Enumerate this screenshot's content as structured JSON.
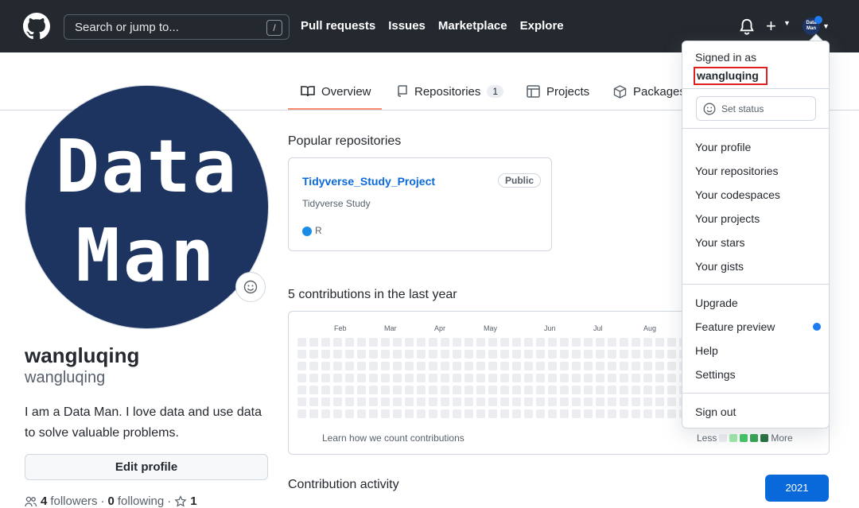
{
  "header": {
    "search_placeholder": "Search or jump to...",
    "search_shortcut": "/",
    "nav": [
      "Pull requests",
      "Issues",
      "Marketplace",
      "Explore"
    ],
    "avatar_text_line1": "Data",
    "avatar_text_line2": "Man"
  },
  "tabs": {
    "overview": "Overview",
    "repositories": "Repositories",
    "repositories_count": "1",
    "projects": "Projects",
    "packages": "Packages"
  },
  "profile": {
    "avatar_line1": "Data",
    "avatar_line2": "Man",
    "fullname": "wangluqing",
    "nickname": "wangluqing",
    "bio": "I am a Data Man. I love data and use data to solve valuable problems.",
    "edit_button": "Edit profile",
    "followers_count": "4",
    "followers_label": "followers",
    "following_count": "0",
    "following_label": "following",
    "stars_count": "1"
  },
  "popular": {
    "heading": "Popular repositories",
    "repo_name": "Tidyverse_Study_Project",
    "repo_visibility": "Public",
    "repo_description": "Tidyverse Study",
    "repo_language": "R",
    "repo_language_color": "#198ce7"
  },
  "contributions": {
    "heading": "5 contributions in the last year",
    "months": [
      "Feb",
      "Mar",
      "Apr",
      "May",
      "Jun",
      "Jul",
      "Aug"
    ],
    "learn_link": "Learn how we count contributions",
    "legend_less": "Less",
    "legend_more": "More",
    "legend_colors": [
      "#ebedf0",
      "#9be9a8",
      "#40c463",
      "#30a14e",
      "#216e39"
    ]
  },
  "activity": {
    "heading": "Contribution activity",
    "year": "2021"
  },
  "dropdown": {
    "signed_in_as": "Signed in as",
    "username": "wangluqing",
    "set_status": "Set status",
    "items": [
      "Your profile",
      "Your repositories",
      "Your codespaces",
      "Your projects",
      "Your stars",
      "Your gists"
    ],
    "upgrade": "Upgrade",
    "feature_preview": "Feature preview",
    "help": "Help",
    "settings": "Settings",
    "sign_out": "Sign out"
  }
}
